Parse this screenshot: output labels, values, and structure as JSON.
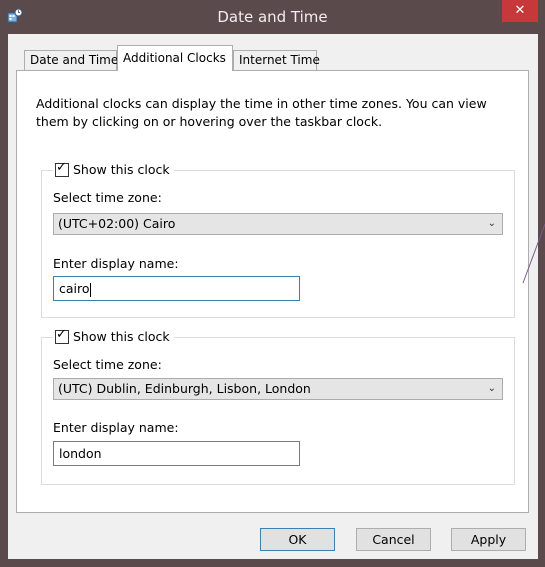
{
  "window": {
    "title": "Date and Time",
    "close_glyph": "✕",
    "app_icon": "date-time-control-panel-icon"
  },
  "tabs": [
    {
      "label": "Date and Time",
      "active": false
    },
    {
      "label": "Additional Clocks",
      "active": true
    },
    {
      "label": "Internet Time",
      "active": false
    }
  ],
  "description": "Additional clocks can display the time in other time zones. You can view them by clicking on or hovering over the taskbar clock.",
  "clocks": [
    {
      "show_label": "Show this clock",
      "checked": true,
      "timezone_label": "Select time zone:",
      "timezone_value": "(UTC+02:00) Cairo",
      "display_name_label": "Enter display name:",
      "display_name_value": "cairo"
    },
    {
      "show_label": "Show this clock",
      "checked": true,
      "timezone_label": "Select time zone:",
      "timezone_value": "(UTC) Dublin, Edinburgh, Lisbon, London",
      "display_name_label": "Enter display name:",
      "display_name_value": "london"
    }
  ],
  "buttons": {
    "ok": "OK",
    "cancel": "Cancel",
    "apply": "Apply"
  },
  "colors": {
    "titlebar": "#5b4a4c",
    "close": "#c7383a",
    "accent_border": "#3c7fb1"
  }
}
